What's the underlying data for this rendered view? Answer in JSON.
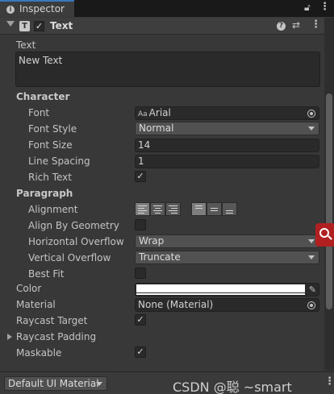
{
  "tab": {
    "icon": "info-icon",
    "label": "Inspector"
  },
  "component": {
    "icon": "text-component-icon",
    "icon_letter": "T",
    "enabled": true,
    "title": "Text"
  },
  "text_section": {
    "label": "Text",
    "value": "New Text"
  },
  "character": {
    "heading": "Character",
    "font_label": "Font",
    "font_value": "Arial",
    "font_icon_text": "Aa",
    "font_style_label": "Font Style",
    "font_style_value": "Normal",
    "font_size_label": "Font Size",
    "font_size_value": "14",
    "line_spacing_label": "Line Spacing",
    "line_spacing_value": "1",
    "rich_text_label": "Rich Text",
    "rich_text_checked": true
  },
  "paragraph": {
    "heading": "Paragraph",
    "alignment_label": "Alignment",
    "alignment_horizontal": "left",
    "alignment_vertical": "top",
    "align_by_geometry_label": "Align By Geometry",
    "align_by_geometry_checked": false,
    "horizontal_overflow_label": "Horizontal Overflow",
    "horizontal_overflow_value": "Wrap",
    "vertical_overflow_label": "Vertical Overflow",
    "vertical_overflow_value": "Truncate",
    "best_fit_label": "Best Fit",
    "best_fit_checked": false
  },
  "color": {
    "label": "Color",
    "value": "#FFFFFF"
  },
  "material": {
    "label": "Material",
    "value": "None (Material)"
  },
  "raycast_target": {
    "label": "Raycast Target",
    "checked": true
  },
  "raycast_padding": {
    "label": "Raycast Padding",
    "expanded": false
  },
  "maskable": {
    "label": "Maskable",
    "checked": true
  },
  "bottom": {
    "material_dropdown": "Default UI Material",
    "watermark": "CSDN @聪  ~smart"
  },
  "colors": {
    "background": "#383838",
    "field": "#2A2A2A",
    "tab_accent": "#3A79BB",
    "search_button": "#B02020"
  }
}
